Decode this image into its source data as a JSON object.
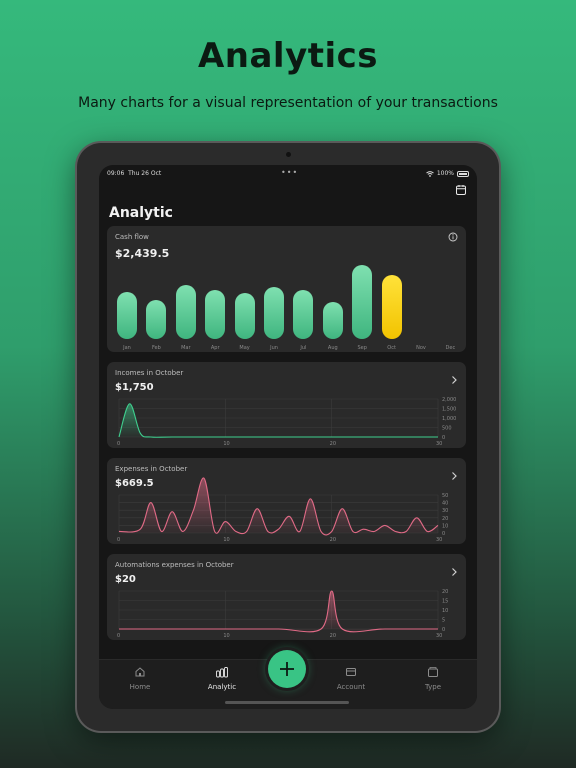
{
  "hero": {
    "title": "Analytics",
    "subtitle": "Many charts for a visual representation of your transactions"
  },
  "status": {
    "time": "09:06",
    "date": "Thu 26 Oct",
    "dots": "•••",
    "battery": "100%"
  },
  "page": {
    "title": "Analytic"
  },
  "cashflow": {
    "label": "Cash flow",
    "value": "$2,439.5"
  },
  "incomes": {
    "label": "Incomes in October",
    "value": "$1,750"
  },
  "expenses": {
    "label": "Expenses in October",
    "value": "$669.5"
  },
  "automations": {
    "label": "Automations expenses in October",
    "value": "$20"
  },
  "tabs": {
    "home": "Home",
    "analytic": "Analytic",
    "account": "Account",
    "type": "Type"
  },
  "colors": {
    "accent": "#39c485",
    "current_bar": "#f2c300",
    "income_line": "#3fd08f",
    "expense_line": "#e06a86"
  },
  "chart_data": [
    {
      "type": "bar",
      "categories": [
        "Jan",
        "Feb",
        "Mar",
        "Apr",
        "May",
        "Jun",
        "Jul",
        "Aug",
        "Sep",
        "Oct",
        "Nov",
        "Dec"
      ],
      "values": [
        190,
        160,
        220,
        200,
        185,
        210,
        200,
        150,
        300,
        260,
        0,
        0
      ],
      "highlight": "Oct",
      "title": "Cash flow"
    },
    {
      "type": "area",
      "title": "Incomes in October",
      "x": [
        0,
        1,
        2,
        3,
        5,
        10,
        15,
        20,
        25,
        30
      ],
      "values": [
        0,
        1750,
        200,
        0,
        0,
        0,
        0,
        0,
        0,
        0
      ],
      "xticks": [
        0,
        10,
        20,
        30
      ],
      "yticks": [
        0,
        500,
        1000,
        1500,
        2000
      ],
      "ylim": [
        0,
        2000
      ]
    },
    {
      "type": "area",
      "title": "Expenses in October",
      "x": [
        0,
        2,
        3,
        4,
        5,
        6,
        7,
        8,
        9,
        10,
        11,
        12,
        13,
        14,
        15,
        16,
        17,
        18,
        19,
        20,
        21,
        22,
        23,
        24,
        25,
        26,
        27,
        28,
        29,
        30
      ],
      "values": [
        2,
        5,
        40,
        2,
        28,
        2,
        30,
        72,
        2,
        15,
        2,
        2,
        32,
        2,
        5,
        22,
        2,
        45,
        2,
        2,
        32,
        2,
        5,
        2,
        10,
        2,
        2,
        20,
        2,
        10
      ],
      "xticks": [
        0,
        10,
        20,
        30
      ],
      "yticks": [
        0,
        10,
        20,
        30,
        40,
        50
      ],
      "ylim": [
        0,
        50
      ]
    },
    {
      "type": "area",
      "title": "Automations expenses in October",
      "x": [
        0,
        5,
        10,
        15,
        19,
        20,
        21,
        25,
        30
      ],
      "values": [
        0,
        0,
        0,
        0,
        0,
        20,
        0,
        0,
        0
      ],
      "xticks": [
        0,
        10,
        20,
        30
      ],
      "yticks": [
        0,
        5,
        10,
        15,
        20
      ],
      "ylim": [
        0,
        20
      ]
    }
  ]
}
